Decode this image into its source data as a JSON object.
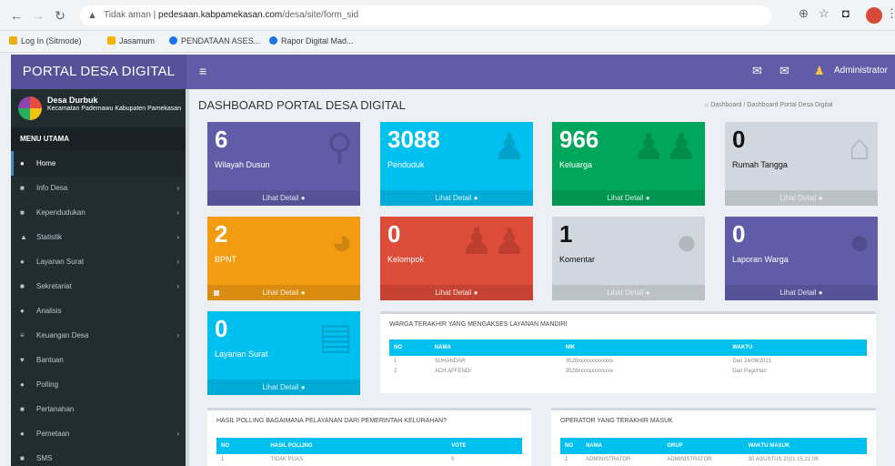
{
  "browser": {
    "not_secure": "Tidak aman",
    "url_host": "pedesaan.kabpamekasan.com",
    "url_path": "/desa/site/form_sid",
    "bookmarks": [
      "Log In (Sitmode)",
      "Jasamum",
      "PENDATAAN ASES...",
      "Rapor Digital Mad..."
    ]
  },
  "app": {
    "logo": "PORTAL DESA DIGITAL",
    "admin_label": "Administrator",
    "user_name": "Desa Durbuk",
    "user_sub": "Kecamatan Pademawu Kabupaten Pamekasan"
  },
  "sidebar": {
    "header": "MENU UTAMA",
    "items": [
      {
        "label": "Home",
        "icon": "●",
        "caret": ""
      },
      {
        "label": "Info Desa",
        "icon": "■",
        "caret": "›"
      },
      {
        "label": "Kependudukan",
        "icon": "■",
        "caret": "›"
      },
      {
        "label": "Statistik",
        "icon": "▲",
        "caret": "›"
      },
      {
        "label": "Layanan Surat",
        "icon": "●",
        "caret": "›"
      },
      {
        "label": "Sekretariat",
        "icon": "■",
        "caret": "›"
      },
      {
        "label": "Analisis",
        "icon": "●",
        "caret": ""
      },
      {
        "label": "Keuangan Desa",
        "icon": "≡",
        "caret": "›"
      },
      {
        "label": "Bantuan",
        "icon": "♥",
        "caret": ""
      },
      {
        "label": "Polling",
        "icon": "●",
        "caret": ""
      },
      {
        "label": "Pertanahan",
        "icon": "■",
        "caret": ""
      },
      {
        "label": "Pemetaan",
        "icon": "●",
        "caret": "›"
      },
      {
        "label": "SMS",
        "icon": "■",
        "caret": ""
      }
    ]
  },
  "content": {
    "title": "DASHBOARD PORTAL DESA DIGITAL",
    "breadcrumb": "Dashboard / Dashboard Portal Desa Digital"
  },
  "stat_boxes": [
    {
      "value": "6",
      "label": "Wilayah Dusun",
      "footer": "Lihat Detail ●",
      "color": "#605ca8"
    },
    {
      "value": "3088",
      "label": "Penduduk",
      "footer": "Lihat Detail ●",
      "color": "#00c0ef"
    },
    {
      "value": "966",
      "label": "Keluarga",
      "footer": "Lihat Detail ●",
      "color": "#00a65a"
    },
    {
      "value": "0",
      "label": "Rumah Tangga",
      "footer": "Lihat Detail ●",
      "color": "#d2d6de"
    },
    {
      "value": "2",
      "label": "BPNT",
      "footer": "Lihat Detail ●",
      "color": "#f39c12"
    },
    {
      "value": "0",
      "label": "Kelompok",
      "footer": "Lihat Detail ●",
      "color": "#dd4b39"
    },
    {
      "value": "1",
      "label": "Komentar",
      "footer": "Lihat Detail ●",
      "color": "#d2d6de"
    },
    {
      "value": "0",
      "label": "Laporan Warga",
      "footer": "Lihat Detail ●",
      "color": "#605ca8"
    },
    {
      "value": "0",
      "label": "Layanan Surat",
      "footer": "Lihat Detail ●",
      "color": "#00c0ef"
    }
  ],
  "panels": {
    "warga": {
      "title": "WARGA TERAKHIR YANG MENGAKSES LAYANAN MANDIRI",
      "headers": [
        "NO",
        "NAMA",
        "NIK",
        "WAKTU"
      ],
      "rows": [
        [
          "1",
          "SUHANDAR",
          "3528xxxxxxxxxxxxx",
          "Dari 24/08/2021"
        ],
        [
          "2",
          "ACH.AFFENDI",
          "3528xxxxxxxxxxxxx",
          "Dari Pagi/Hari"
        ]
      ]
    },
    "polling": {
      "title": "HASIL POLLING BAGAIMANA PELAYANAN DARI PEMERINTAH KELURAHAN?",
      "headers": [
        "NO",
        "HASIL POLLING",
        "VOTE"
      ],
      "rows": [
        [
          "1",
          "TIDAK PUAS",
          "0"
        ]
      ]
    },
    "operator": {
      "title": "OPERATOR YANG TERAKHIR MASUK",
      "headers": [
        "NO",
        "NAMA",
        "GRUP",
        "WAKTU MASUK"
      ],
      "rows": [
        [
          "1",
          "ADMINISTRATOR",
          "ADMINISTRATOR",
          "30 AGUSTUS 2021 15:21:06"
        ]
      ]
    }
  }
}
